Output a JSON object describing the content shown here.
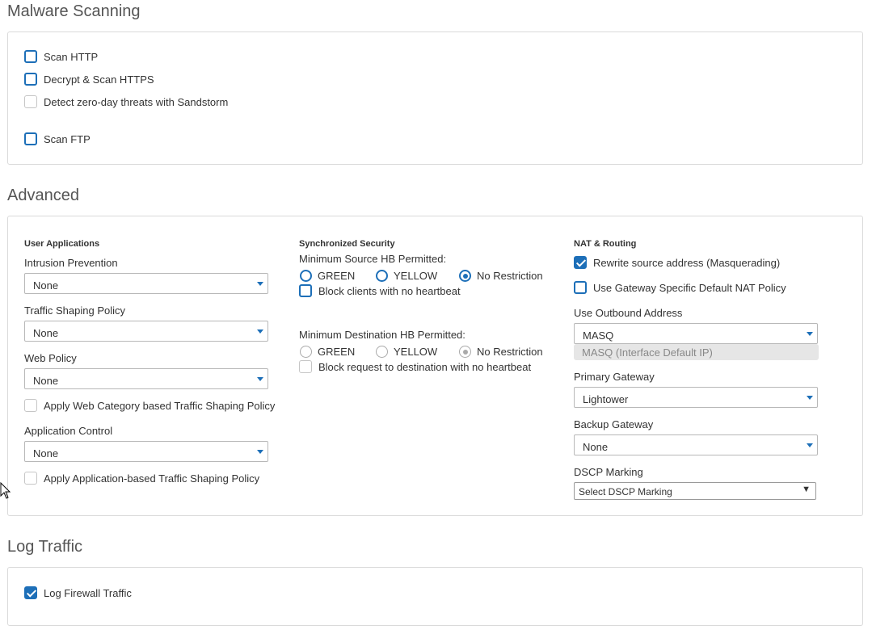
{
  "malware": {
    "title": "Malware Scanning",
    "options": [
      {
        "label": "Scan HTTP",
        "checked": false,
        "disabled": false
      },
      {
        "label": "Decrypt & Scan HTTPS",
        "checked": false,
        "disabled": false
      },
      {
        "label": "Detect zero-day threats with Sandstorm",
        "checked": false,
        "disabled": true
      },
      {
        "label": "Scan FTP",
        "checked": false,
        "disabled": false
      }
    ]
  },
  "advanced": {
    "title": "Advanced",
    "user_apps": {
      "heading": "User Applications",
      "intrusion_label": "Intrusion Prevention",
      "intrusion_value": "None",
      "traffic_label": "Traffic Shaping Policy",
      "traffic_value": "None",
      "web_label": "Web Policy",
      "web_value": "None",
      "web_shaping_label": "Apply Web Category based Traffic Shaping Policy",
      "app_control_label": "Application Control",
      "app_control_value": "None",
      "app_shaping_label": "Apply Application-based Traffic Shaping Policy"
    },
    "sync_security": {
      "heading": "Synchronized Security",
      "min_source_label": "Minimum Source HB Permitted:",
      "source_options": [
        "GREEN",
        "YELLOW",
        "No Restriction"
      ],
      "source_selected": "No Restriction",
      "block_clients_label": "Block clients with no heartbeat",
      "min_dest_label": "Minimum Destination HB Permitted:",
      "dest_options": [
        "GREEN",
        "YELLOW",
        "No Restriction"
      ],
      "dest_selected": "No Restriction",
      "block_request_label": "Block request to destination with no heartbeat"
    },
    "nat": {
      "heading": "NAT & Routing",
      "rewrite_label": "Rewrite source address (Masquerading)",
      "rewrite_checked": true,
      "gateway_nat_label": "Use Gateway Specific Default NAT Policy",
      "outbound_label": "Use Outbound Address",
      "outbound_value": "MASQ",
      "outbound_hint": "MASQ (Interface Default IP)",
      "primary_label": "Primary Gateway",
      "primary_value": "Lightower",
      "backup_label": "Backup Gateway",
      "backup_value": "None",
      "dscp_label": "DSCP Marking",
      "dscp_value": "Select DSCP Marking"
    }
  },
  "log": {
    "title": "Log Traffic",
    "firewall_label": "Log Firewall Traffic",
    "firewall_checked": true
  },
  "colors": {
    "accent": "#1d6fb8",
    "border": "#dadada"
  }
}
